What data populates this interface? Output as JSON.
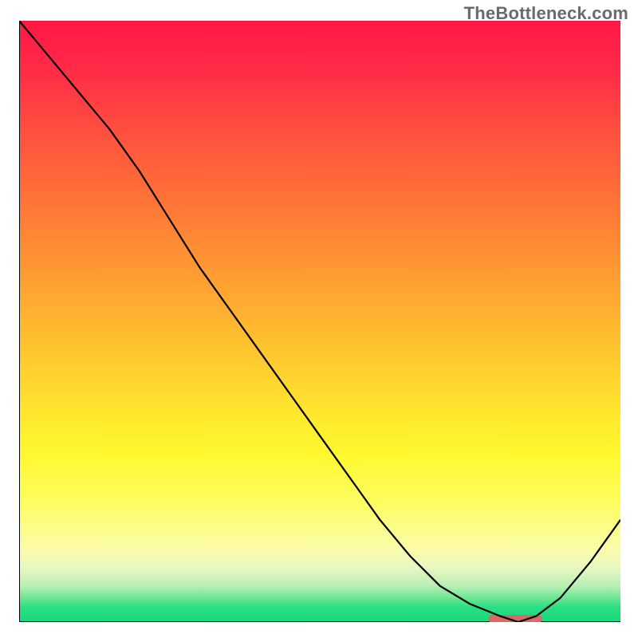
{
  "attribution": "TheBottleneck.com",
  "chart_data": {
    "type": "line",
    "title": "",
    "xlabel": "",
    "ylabel": "",
    "ylim": [
      0,
      1
    ],
    "xlim": [
      0,
      1
    ],
    "grid": false,
    "legend": false,
    "series": [
      {
        "name": "curve",
        "x": [
          0.0,
          0.05,
          0.1,
          0.15,
          0.2,
          0.25,
          0.3,
          0.35,
          0.4,
          0.45,
          0.5,
          0.55,
          0.6,
          0.65,
          0.7,
          0.75,
          0.8,
          0.83,
          0.86,
          0.9,
          0.95,
          1.0
        ],
        "values": [
          1.0,
          0.94,
          0.88,
          0.82,
          0.75,
          0.67,
          0.59,
          0.52,
          0.45,
          0.38,
          0.31,
          0.24,
          0.17,
          0.11,
          0.06,
          0.03,
          0.01,
          0.0,
          0.01,
          0.04,
          0.1,
          0.17
        ]
      }
    ],
    "marker": {
      "x0": 0.78,
      "x1": 0.87,
      "y": 0.0
    },
    "colors": {
      "gradient_top": "#ff1846",
      "gradient_mid": "#ffe92e",
      "gradient_bottom": "#17d97c",
      "curve": "#000000",
      "marker": "#d66a67",
      "axis": "#000000"
    }
  }
}
